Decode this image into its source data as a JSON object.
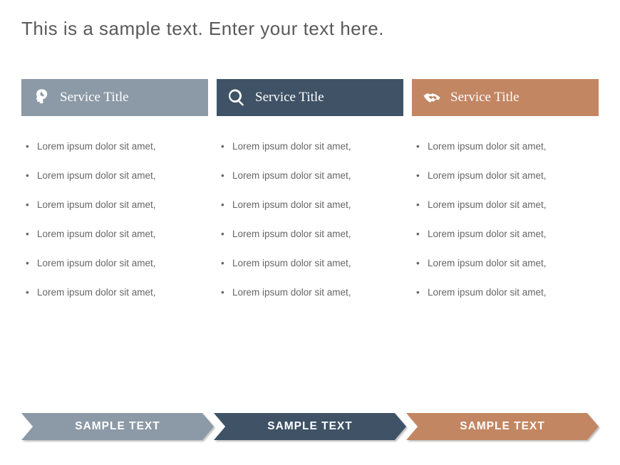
{
  "title": "This is a sample text. Enter your text here.",
  "columns": [
    {
      "header": "Service Title",
      "icon": "head-gear-icon",
      "items": [
        "Lorem ipsum dolor sit amet,",
        "Lorem ipsum dolor sit amet,",
        "Lorem ipsum dolor sit amet,",
        "Lorem ipsum dolor sit amet,",
        "Lorem ipsum dolor sit amet,",
        "Lorem ipsum dolor sit amet,"
      ]
    },
    {
      "header": "Service Title",
      "icon": "search-icon",
      "items": [
        "Lorem ipsum dolor sit amet,",
        "Lorem ipsum dolor sit amet,",
        "Lorem ipsum dolor sit amet,",
        "Lorem ipsum dolor sit amet,",
        "Lorem ipsum dolor sit amet,",
        "Lorem ipsum dolor sit amet,"
      ]
    },
    {
      "header": "Service Title",
      "icon": "handshake-icon",
      "items": [
        "Lorem ipsum dolor sit amet,",
        "Lorem ipsum dolor sit amet,",
        "Lorem ipsum dolor sit amet,",
        "Lorem ipsum dolor sit amet,",
        "Lorem ipsum dolor sit amet,",
        "Lorem ipsum dolor sit amet,"
      ]
    }
  ],
  "arrows": [
    {
      "label": "SAMPLE TEXT"
    },
    {
      "label": "SAMPLE TEXT"
    },
    {
      "label": "SAMPLE TEXT"
    }
  ],
  "colors": {
    "col1": "#8c99a6",
    "col2": "#3f5266",
    "col3": "#c28662"
  }
}
